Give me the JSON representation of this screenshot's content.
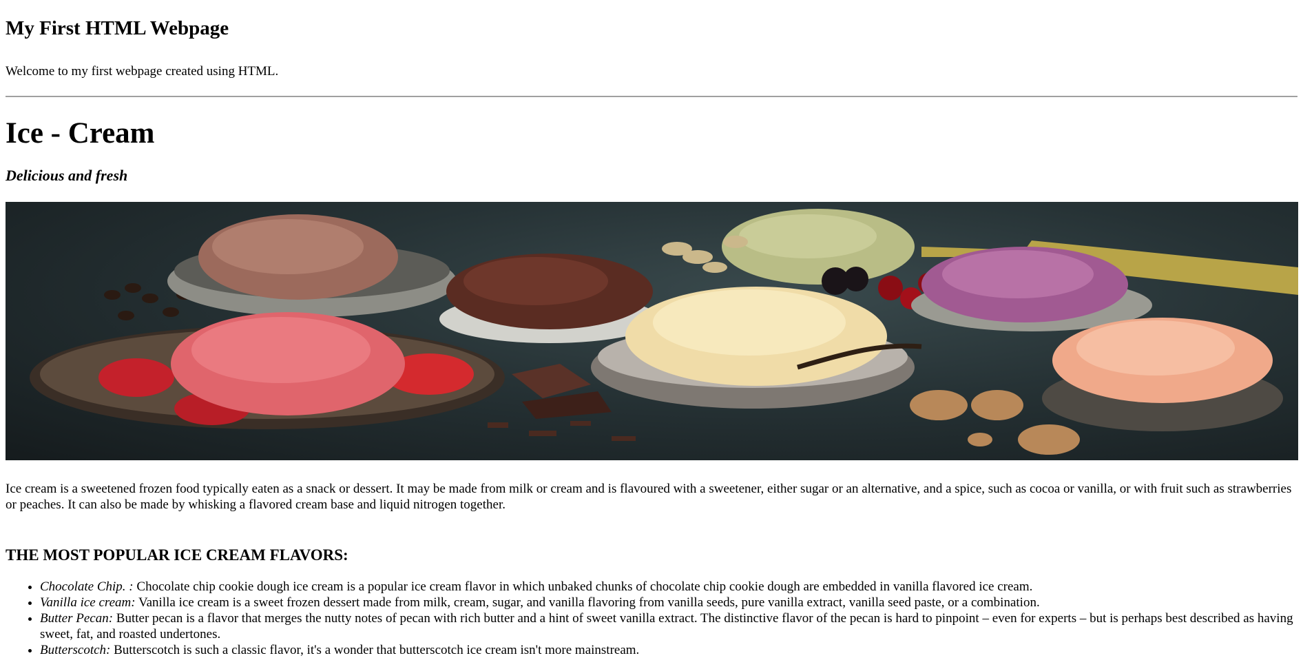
{
  "header": {
    "title": "My First HTML Webpage",
    "welcome": "Welcome to my first webpage created using HTML."
  },
  "section": {
    "title": "Ice - Cream",
    "tagline": "Delicious and fresh"
  },
  "hero_image": {
    "subject": "assorted ice cream scoops in bowls"
  },
  "intro": "Ice cream is a sweetened frozen food typically eaten as a snack or dessert. It may be made from milk or cream and is flavoured with a sweetener, either sugar or an alternative, and a spice, such as cocoa or vanilla, or with fruit such as strawberries or peaches. It can also be made by whisking a flavored cream base and liquid nitrogen together.",
  "flavors": {
    "title": "THE MOST POPULAR ICE CREAM FLAVORS:",
    "items": [
      {
        "name": "Chocolate Chip. :",
        "text": " Chocolate chip cookie dough ice cream is a popular ice cream flavor in which unbaked chunks of chocolate chip cookie dough are embedded in vanilla flavored ice cream."
      },
      {
        "name": "Vanilla ice cream:",
        "text": " Vanilla ice cream is a sweet frozen dessert made from milk, cream, sugar, and vanilla flavoring from vanilla seeds, pure vanilla extract, vanilla seed paste, or a combination."
      },
      {
        "name": "Butter Pecan:",
        "text": " Butter pecan is a flavor that merges the nutty notes of pecan with rich butter and a hint of sweet vanilla extract. The distinctive flavor of the pecan is hard to pinpoint – even for experts – but is perhaps best described as having sweet, fat, and roasted undertones."
      },
      {
        "name": "Butterscotch:",
        "text": " Butterscotch is such a classic flavor, it's a wonder that butterscotch ice cream isn't more mainstream."
      }
    ]
  }
}
